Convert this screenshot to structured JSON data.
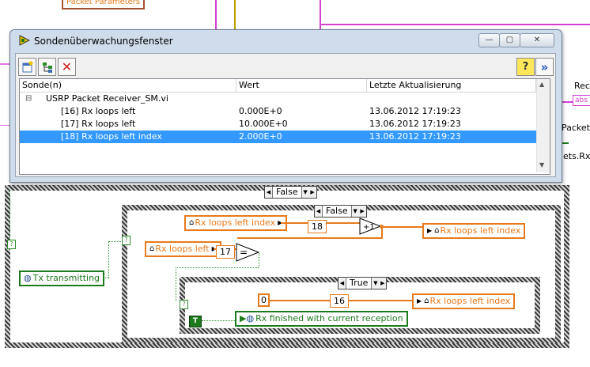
{
  "diagram": {
    "top_cluster_label": "Packet Parameters",
    "right_label_1": "Rece",
    "right_label_2": "Packets",
    "right_label_3": "ets.Rx",
    "right_label_4": "abs",
    "outer_case": {
      "selector_value": "False"
    },
    "middle_case": {
      "selector_value": "False"
    },
    "inner_case": {
      "selector_value": "True"
    },
    "nodes": {
      "rx_loops_left_index_local": "Rx loops left index",
      "rx_loops_left_local": "Rx loops left",
      "rx_loops_left_index_write_1": "Rx loops left index",
      "rx_loops_left_index_write_2": "Rx loops left index",
      "tx_transmitting": "Tx transmitting",
      "rx_finished": "Rx finished with current reception"
    },
    "probes": {
      "p18": "18",
      "p17": "17",
      "p16": "16"
    },
    "constants": {
      "zero": "0",
      "true_const": "T"
    },
    "functions": {
      "increment": "+1",
      "equal": "="
    },
    "case_terminal": "?"
  },
  "window": {
    "title": "Sondenüberwachungsfenster",
    "caption_buttons": {
      "minimize": "—",
      "restore": "▢",
      "close": "✕"
    },
    "toolbar": {
      "help": "?",
      "expand": "»"
    },
    "columns": [
      "Sonde(n)",
      "Wert",
      "Letzte Aktualisierung"
    ],
    "tree_root": {
      "toggle": "⊟",
      "label": "USRP Packet Receiver_SM.vi"
    },
    "rows": [
      {
        "probe": "[16] Rx loops left",
        "value": "0.000E+0",
        "updated": "13.06.2012 17:19:23",
        "selected": false
      },
      {
        "probe": "[17] Rx loops left",
        "value": "10.000E+0",
        "updated": "13.06.2012 17:19:23",
        "selected": false
      },
      {
        "probe": "[18] Rx loops left index",
        "value": "2.000E+0",
        "updated": "13.06.2012 17:19:23",
        "selected": true
      }
    ]
  },
  "icons": {
    "app": "labview-probe-icon",
    "new": "new-probe-icon",
    "tree": "tree-view-icon",
    "delete": "delete-probe-icon",
    "help": "help-icon",
    "expand": "expand-icon",
    "local_variable": "house-icon",
    "global_var": "globe-icon"
  },
  "colors": {
    "orange_wire": "#e87a1b",
    "green_wire": "#1d7a1d",
    "pink_wire": "#d33fd3",
    "selection": "#3399ff"
  }
}
